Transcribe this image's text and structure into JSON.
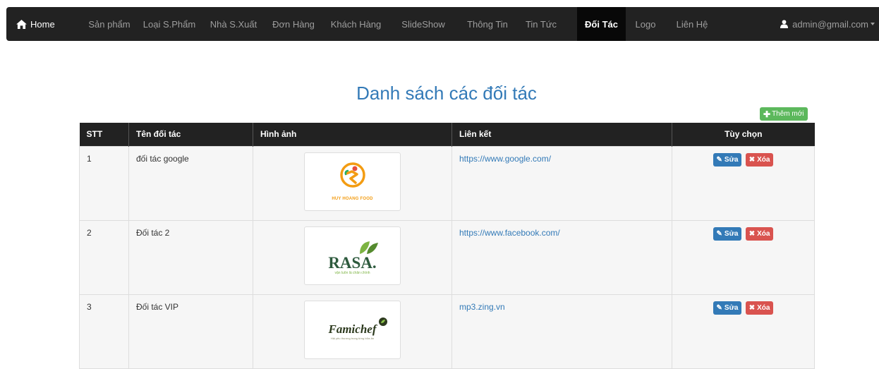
{
  "nav": {
    "home": "Home",
    "items": [
      "Sản phẩm",
      "Loại S.Phẩm",
      "Nhà S.Xuất",
      "Đơn Hàng",
      "Khách Hàng",
      "SlideShow",
      "Thông Tin",
      "Tin Tức",
      "Đối Tác",
      "Logo",
      "Liên Hệ"
    ],
    "active": "Đối Tác",
    "user": "admin@gmail.com"
  },
  "page": {
    "title": "Danh sách các đối tác",
    "add_label": "Thêm mới"
  },
  "table": {
    "headers": [
      "STT",
      "Tên đối tác",
      "Hình ảnh",
      "Liên kết",
      "Tùy chọn"
    ],
    "rows": [
      {
        "stt": "1",
        "name": "đối tác google",
        "logo": "HUY HOANG FOOD",
        "link": "https://www.google.com/",
        "edit": "Sửa",
        "delete": "Xóa"
      },
      {
        "stt": "2",
        "name": "Đối tác 2",
        "logo": "RASA.",
        "logo_sub": "vận luôn là chân chính",
        "link": "https://www.facebook.com/",
        "edit": "Sửa",
        "delete": "Xóa"
      },
      {
        "stt": "3",
        "name": "Đối tác VIP",
        "logo": "Famichef",
        "logo_sub": "Hải yêu thương trong từng bữa ăn",
        "link": "mp3.zing.vn",
        "edit": "Sửa",
        "delete": "Xóa"
      }
    ]
  },
  "colors": {
    "navbar": "#222222",
    "accent": "#337ab7",
    "success": "#5cb85c",
    "danger": "#d9534f"
  }
}
